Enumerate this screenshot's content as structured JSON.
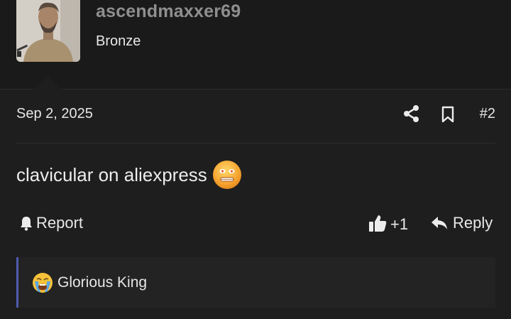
{
  "author": {
    "username": "ascendmaxxer69",
    "rank": "Bronze",
    "avatar_icon": "user-avatar-photo"
  },
  "post": {
    "date": "Sep 2, 2025",
    "number": "#2",
    "body": "clavicular on aliexpress",
    "body_emoji": "face-grimace-emoji"
  },
  "actions": {
    "report_label": "Report",
    "like_count": "+1",
    "reply_label": "Reply"
  },
  "reactions": {
    "emoji": "loudly-crying-face-emoji",
    "label": "Glorious King"
  },
  "colors": {
    "background": "#1e1e1e",
    "header_bg": "#1a1a1a",
    "username": "#8f8f8f",
    "reaction_border": "#4f5bb0"
  }
}
